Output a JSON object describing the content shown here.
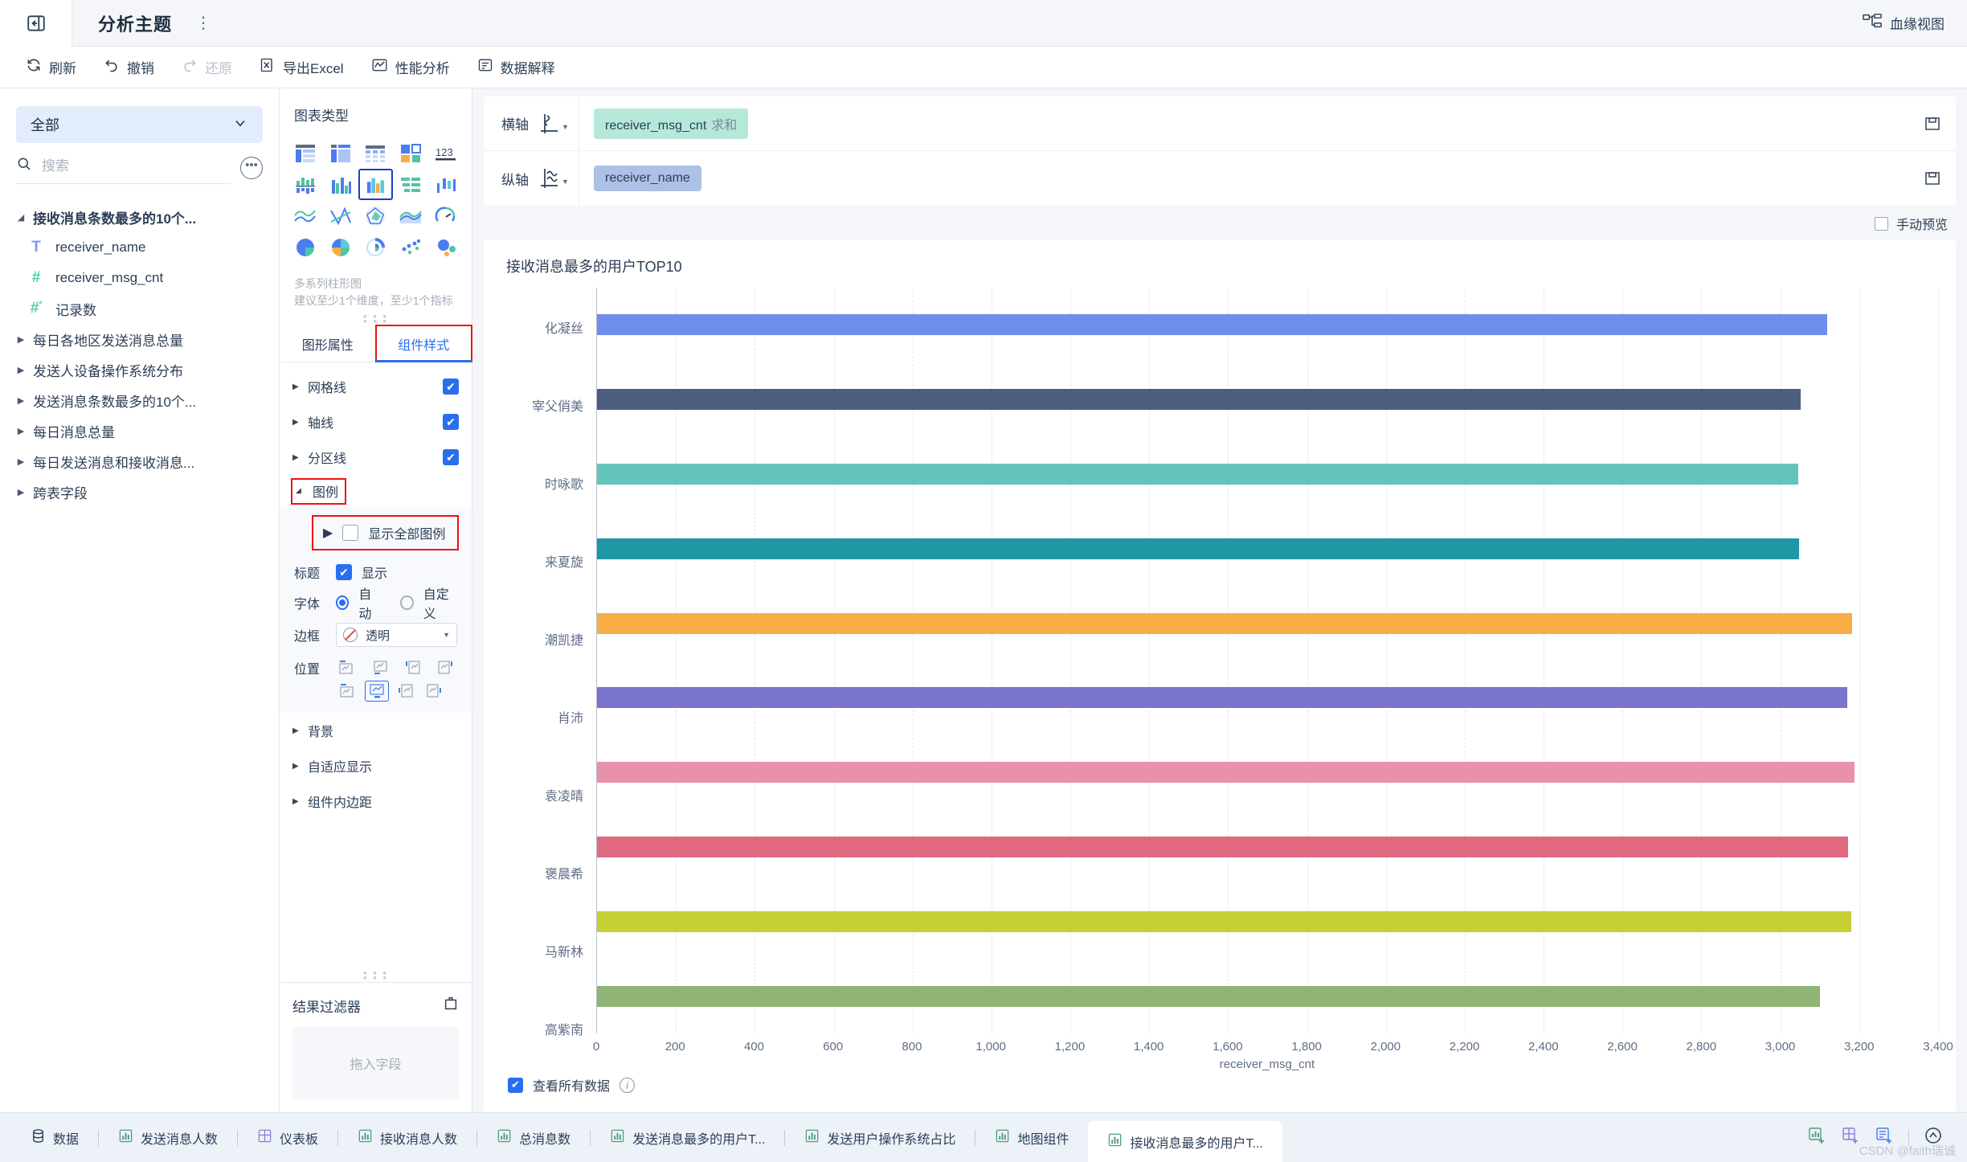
{
  "titlebar": {
    "collapse_icon": "panel-collapse-icon",
    "title": "分析主题",
    "menu_dots": "⋮",
    "lineage_label": "血缘视图"
  },
  "toolbar": {
    "items": [
      {
        "label": "刷新",
        "icon": "refresh-icon",
        "disabled": false
      },
      {
        "label": "撤销",
        "icon": "undo-icon",
        "disabled": false
      },
      {
        "label": "还原",
        "icon": "redo-icon",
        "disabled": true
      },
      {
        "label": "导出Excel",
        "icon": "excel-icon",
        "disabled": false
      },
      {
        "label": "性能分析",
        "icon": "performance-icon",
        "disabled": false
      },
      {
        "label": "数据解释",
        "icon": "data-explain-icon",
        "disabled": false
      }
    ]
  },
  "sidebar": {
    "dataset_select": "全部",
    "search_placeholder": "搜索",
    "search_value": "",
    "tree": [
      {
        "label": "接收消息条数最多的10个...",
        "expanded": true,
        "type": "group"
      },
      {
        "label": "receiver_name",
        "type": "field",
        "ftype": "T"
      },
      {
        "label": "receiver_msg_cnt",
        "type": "field",
        "ftype": "#"
      },
      {
        "label": "记录数",
        "type": "field",
        "ftype": "#*"
      },
      {
        "label": "每日各地区发送消息总量",
        "expanded": false,
        "type": "group"
      },
      {
        "label": "发送人设备操作系统分布",
        "expanded": false,
        "type": "group"
      },
      {
        "label": "发送消息条数最多的10个...",
        "expanded": false,
        "type": "group"
      },
      {
        "label": "每日消息总量",
        "expanded": false,
        "type": "group"
      },
      {
        "label": "每日发送消息和接收消息...",
        "expanded": false,
        "type": "group"
      },
      {
        "label": "跨表字段",
        "expanded": false,
        "type": "group"
      }
    ]
  },
  "config": {
    "chart_type_title": "图表类型",
    "chart_types": [
      "table-basic",
      "table-crosstab",
      "table-detail",
      "kpi-cards",
      "number-123",
      "bar-grouped-vertical",
      "bar-multi",
      "bar-multi-series",
      "bar-horizontal",
      "bar-range",
      "line-multi",
      "line-cross",
      "radar",
      "area",
      "gauge",
      "pie",
      "pie-rose",
      "donut",
      "scatter",
      "bubble"
    ],
    "selected_chart_index": 7,
    "desc_line1": "多系列柱形图",
    "desc_line2": "建议至少1个维度，至少1个指标",
    "tabs": [
      {
        "label": "图形属性",
        "active": false
      },
      {
        "label": "组件样式",
        "active": true
      }
    ],
    "sections": [
      {
        "label": "网格线",
        "checked": true
      },
      {
        "label": "轴线",
        "checked": true
      },
      {
        "label": "分区线",
        "checked": true
      }
    ],
    "legend": {
      "label": "图例",
      "expanded": true,
      "show_all_label": "显示全部图例",
      "show_all_checked": false,
      "title_label": "标题",
      "title_show_label": "显示",
      "title_show_checked": true,
      "font_label": "字体",
      "font_auto_label": "自动",
      "font_custom_label": "自定义",
      "font_selected": "自动",
      "border_label": "边框",
      "border_value": "透明",
      "position_label": "位置",
      "position_selected_index": 5
    },
    "more_sections": [
      {
        "label": "背景"
      },
      {
        "label": "自适应显示"
      },
      {
        "label": "组件内边距"
      }
    ],
    "filter": {
      "title": "结果过滤器",
      "drop_placeholder": "拖入字段",
      "icon": "filter-panel-icon"
    }
  },
  "axes": {
    "x": {
      "label": "横轴",
      "icon": "x-axis-icon",
      "field": "receiver_msg_cnt",
      "agg": "求和"
    },
    "y": {
      "label": "纵轴",
      "icon": "y-axis-icon",
      "field": "receiver_name",
      "agg": ""
    },
    "action_icon": "save-icon",
    "manual_preview_label": "手动预览",
    "manual_preview_checked": false
  },
  "footer": {
    "view_all_label": "查看所有数据",
    "view_all_checked": true,
    "info_icon": "info-icon"
  },
  "chart_data": {
    "type": "bar",
    "orientation": "horizontal",
    "title": "接收消息最多的用户TOP10",
    "xlabel": "receiver_msg_cnt",
    "ylabel": "",
    "xlim": [
      0,
      3400
    ],
    "xticks": [
      0,
      200,
      400,
      600,
      800,
      1000,
      1200,
      1400,
      1600,
      1800,
      2000,
      2200,
      2400,
      2600,
      2800,
      3000,
      3200,
      3400
    ],
    "xtick_labels": [
      "0",
      "200",
      "400",
      "600",
      "800",
      "1,000",
      "1,200",
      "1,400",
      "1,600",
      "1,800",
      "2,000",
      "2,200",
      "2,400",
      "2,600",
      "2,800",
      "3,000",
      "3,200",
      "3,400"
    ],
    "grid": true,
    "legend": false,
    "categories": [
      "化凝丝",
      "宰父俏美",
      "时咏歌",
      "来夏旋",
      "潮凯捷",
      "肖沛",
      "袁凌晴",
      "褒晨希",
      "马新林",
      "高紫南"
    ],
    "values": [
      3118,
      3052,
      3045,
      3048,
      3182,
      3170,
      3188,
      3172,
      3180,
      3100
    ],
    "colors": [
      "#6f8ded",
      "#4c5e80",
      "#62c4bb",
      "#1f97a5",
      "#f8ad46",
      "#7b74cc",
      "#e891ab",
      "#e0697f",
      "#c6cf33",
      "#8fb474"
    ]
  },
  "tabbar": {
    "items": [
      {
        "label": "数据",
        "icon": "database-icon",
        "active": false
      },
      {
        "label": "发送消息人数",
        "icon": "chart-icon",
        "active": false
      },
      {
        "label": "仪表板",
        "icon": "dashboard-icon",
        "active": false
      },
      {
        "label": "接收消息人数",
        "icon": "chart-icon",
        "active": false
      },
      {
        "label": "总消息数",
        "icon": "chart-icon",
        "active": false
      },
      {
        "label": "发送消息最多的用户T...",
        "icon": "chart-icon",
        "active": false
      },
      {
        "label": "发送用户操作系统占比",
        "icon": "chart-icon",
        "active": false
      },
      {
        "label": "地图组件",
        "icon": "chart-icon",
        "active": false
      },
      {
        "label": "接收消息最多的用户T...",
        "icon": "chart-icon",
        "active": true
      }
    ],
    "end_buttons": [
      "add-chart-icon",
      "add-dashboard-icon",
      "add-page-icon",
      "collapse-up-icon"
    ],
    "watermark": "CSDN @faith瑞诚"
  }
}
